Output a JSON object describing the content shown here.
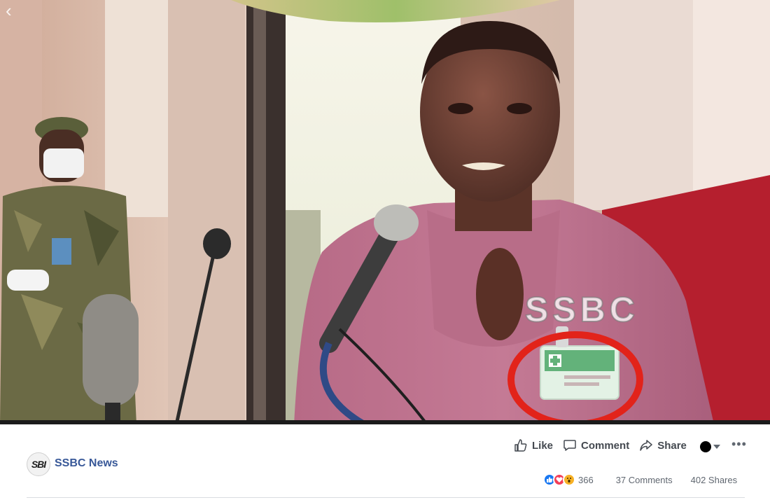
{
  "post": {
    "page_name": "SSBC News",
    "page_logo_text": "SBI"
  },
  "video": {
    "watermark": "SSBC",
    "back_icon": "chevron-left-icon"
  },
  "actions": {
    "like": "Like",
    "comment": "Comment",
    "share": "Share"
  },
  "stats": {
    "reactions_count": "366",
    "comments": "37 Comments",
    "shares": "402 Shares"
  },
  "icons": {
    "like": "thumbs-up-icon",
    "comment": "speech-bubble-icon",
    "share": "share-arrow-icon",
    "more": "more-horizontal-icon"
  },
  "colors": {
    "link": "#385898",
    "annotation": "#e2231a",
    "like_reaction": "#1877f2",
    "love_reaction": "#f33e58",
    "wow_reaction": "#f7b125"
  }
}
